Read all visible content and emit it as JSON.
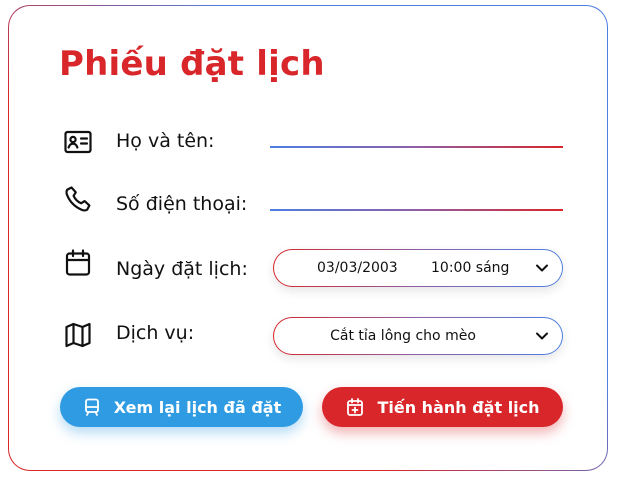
{
  "form": {
    "title": "Phiếu đặt lịch",
    "name_label": "Họ và tên:",
    "name_value": "",
    "phone_label": "Số điện thoại:",
    "phone_value": "",
    "date_label": "Ngày đặt lịch:",
    "date_value": "03/03/2003",
    "time_value": "10:00 sáng",
    "service_label": "Dịch vụ:",
    "service_value": "Cắt tỉa lông cho mèo"
  },
  "buttons": {
    "review_label": "Xem lại lịch đã đặt",
    "book_label": "Tiến hành đặt lịch"
  },
  "icons": {
    "name": "id-card-icon",
    "phone": "phone-icon",
    "date": "calendar-icon",
    "service": "map-icon",
    "review": "bus-icon",
    "book": "calendar-plus-icon",
    "dropdown": "chevron-down-icon"
  },
  "colors": {
    "brand_red": "#d8262a",
    "brand_blue": "#2e9be3",
    "accent_blue": "#4d7fe3"
  }
}
